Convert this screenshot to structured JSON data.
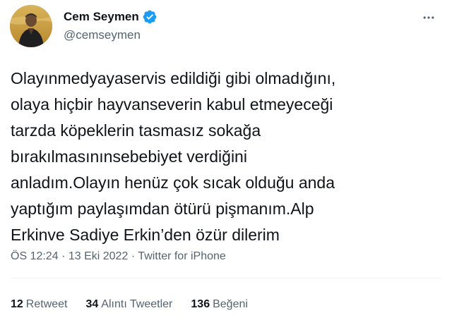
{
  "user": {
    "display_name": "Cem Seymen",
    "handle": "@cemseymen",
    "verified": true,
    "avatar_icon": "profile-photo"
  },
  "more_icon": "more-horizontal-icon",
  "tweet": {
    "lines": [
      "Olayınmedyayaservis edildiği gibi olmadığını,",
      "olaya hiçbir hayvanseverin kabul etmeyeceği",
      "tarzda köpeklerin tasmasız sokağa",
      "bırakılmasınınsebebiyet verdiğini",
      "anladım.Olayın henüz çok sıcak olduğu anda",
      "yaptığım paylaşımdan ötürü pişmanım.Alp",
      "Erkinve Sadiye Erkin’den özür dilerim"
    ]
  },
  "meta": {
    "time": "ÖS 12:24",
    "separator": "·",
    "date": "13 Eki 2022",
    "source": "Twitter for iPhone"
  },
  "stats": {
    "retweets_count": "12",
    "retweets_label": "Retweet",
    "quotes_count": "34",
    "quotes_label": "Alıntı Tweetler",
    "likes_count": "136",
    "likes_label": "Beğeni"
  },
  "colors": {
    "verified_blue": "#1d9bf0",
    "secondary_text": "#536471",
    "primary_text": "#0f1419",
    "divider": "#eff3f4"
  }
}
